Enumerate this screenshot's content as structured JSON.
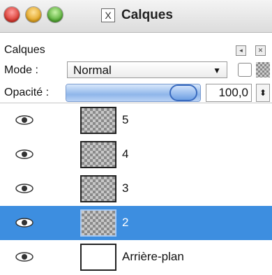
{
  "window": {
    "title": "Calques",
    "app_icon": "x11-icon"
  },
  "panel": {
    "label": "Calques"
  },
  "mode": {
    "label": "Mode :",
    "value": "Normal"
  },
  "opacity": {
    "label": "Opacité :",
    "value": "100,0",
    "fraction": 1.0
  },
  "layers": [
    {
      "name": "5",
      "visible": true,
      "selected": false,
      "thumbnail": "transparent"
    },
    {
      "name": "4",
      "visible": true,
      "selected": false,
      "thumbnail": "transparent"
    },
    {
      "name": "3",
      "visible": true,
      "selected": false,
      "thumbnail": "transparent"
    },
    {
      "name": "2",
      "visible": true,
      "selected": true,
      "thumbnail": "transparent"
    },
    {
      "name": "Arrière-plan",
      "visible": true,
      "selected": false,
      "thumbnail": "white"
    }
  ],
  "colors": {
    "selection": "#3d8ee0",
    "slider_fill": "#8fb6ea"
  }
}
